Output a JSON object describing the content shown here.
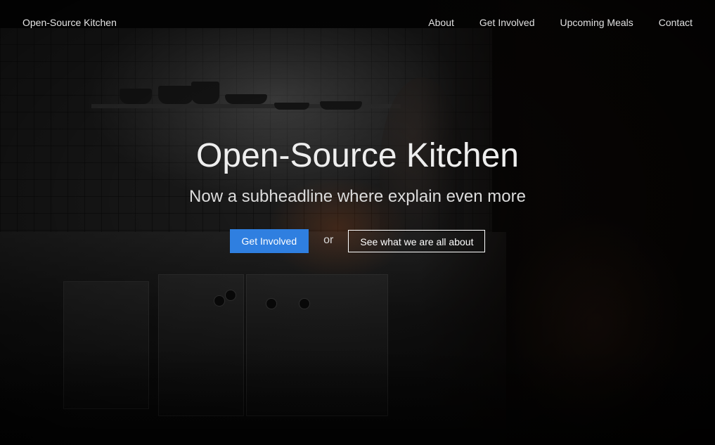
{
  "nav": {
    "brand": "Open-Source Kitchen",
    "links": [
      {
        "label": "About"
      },
      {
        "label": "Get Involved"
      },
      {
        "label": "Upcoming Meals"
      },
      {
        "label": "Contact"
      }
    ]
  },
  "hero": {
    "title": "Open-Source Kitchen",
    "subtitle": "Now a subheadline where explain even more",
    "primary_button": "Get Involved",
    "separator": "or",
    "secondary_button": "See what we are all about"
  },
  "colors": {
    "primary_button_bg": "#2f7fe0",
    "text": "#eeeeee",
    "background": "#050505"
  }
}
